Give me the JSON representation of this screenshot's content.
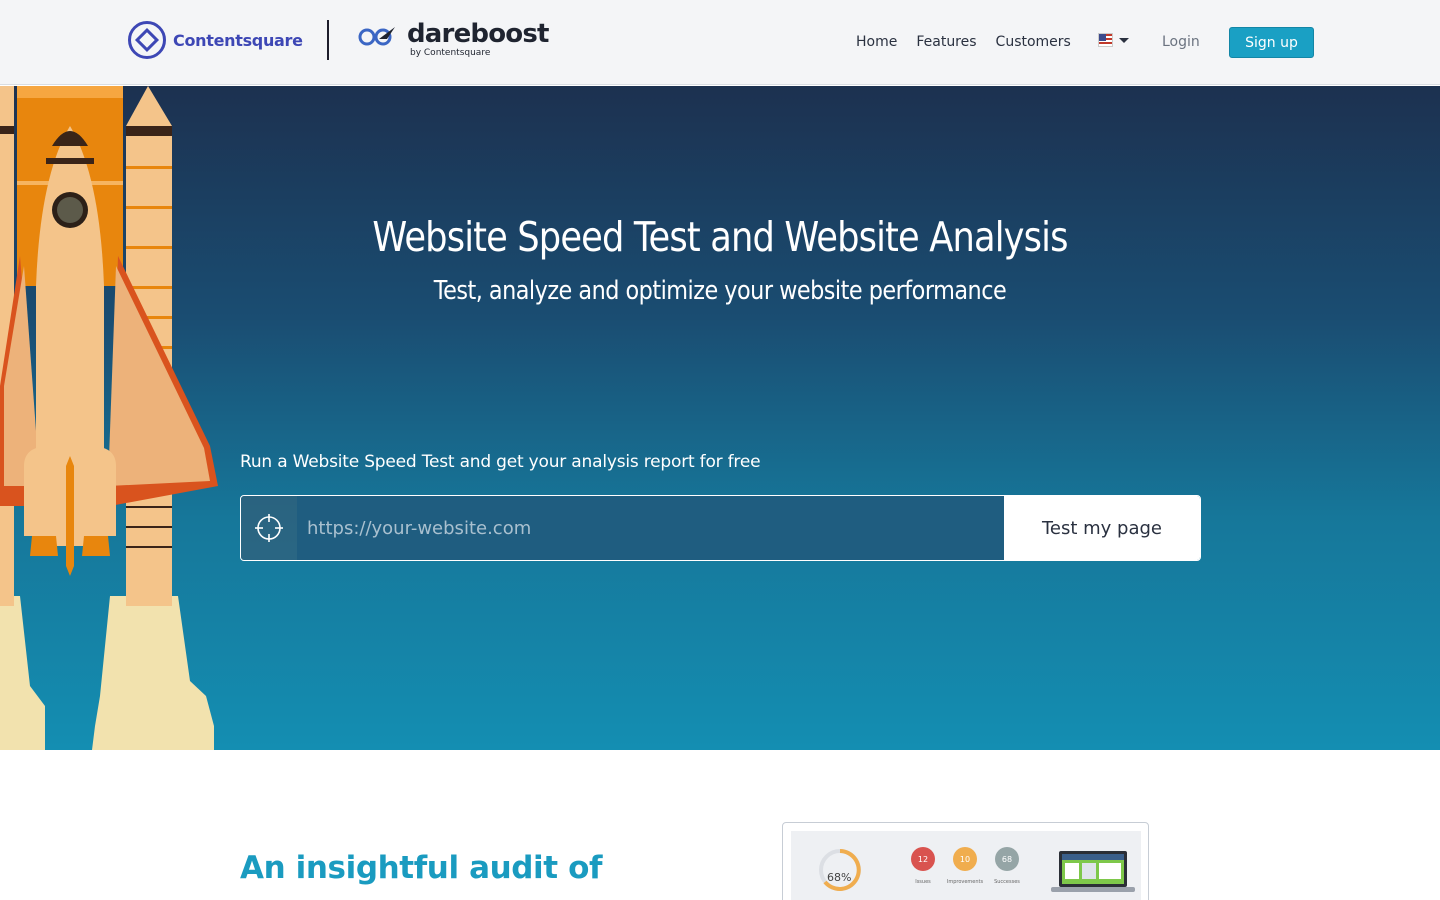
{
  "header": {
    "brand_primary": "Contentsquare",
    "brand_secondary": "dareboost",
    "brand_secondary_by": "by Contentsquare",
    "nav": [
      {
        "label": "Home"
      },
      {
        "label": "Features"
      },
      {
        "label": "Customers"
      }
    ],
    "language_icon": "us-flag-icon",
    "login_label": "Login",
    "signup_label": "Sign up"
  },
  "hero": {
    "title": "Website Speed Test and Website Analysis",
    "subtitle": "Test, analyze and optimize your website performance",
    "cta_label": "Run a Website Speed Test and get your analysis report for free",
    "url_placeholder": "https://your-website.com",
    "url_icon": "crosshair-icon",
    "test_button_label": "Test my page"
  },
  "audit": {
    "heading_line1": "An insightful audit of",
    "preview": {
      "score": "68%",
      "stats": [
        {
          "value": "12",
          "label": "Issues",
          "color": "#d9534f"
        },
        {
          "value": "10",
          "label": "Improvements",
          "color": "#f0ad4e"
        },
        {
          "value": "68",
          "label": "Successes",
          "color": "#95a5a6"
        }
      ]
    }
  },
  "colors": {
    "accent": "#1aa0c4",
    "brand_contentsquare": "#3d47b5",
    "hero_top": "#1c3150",
    "hero_bottom": "#148eb2"
  }
}
